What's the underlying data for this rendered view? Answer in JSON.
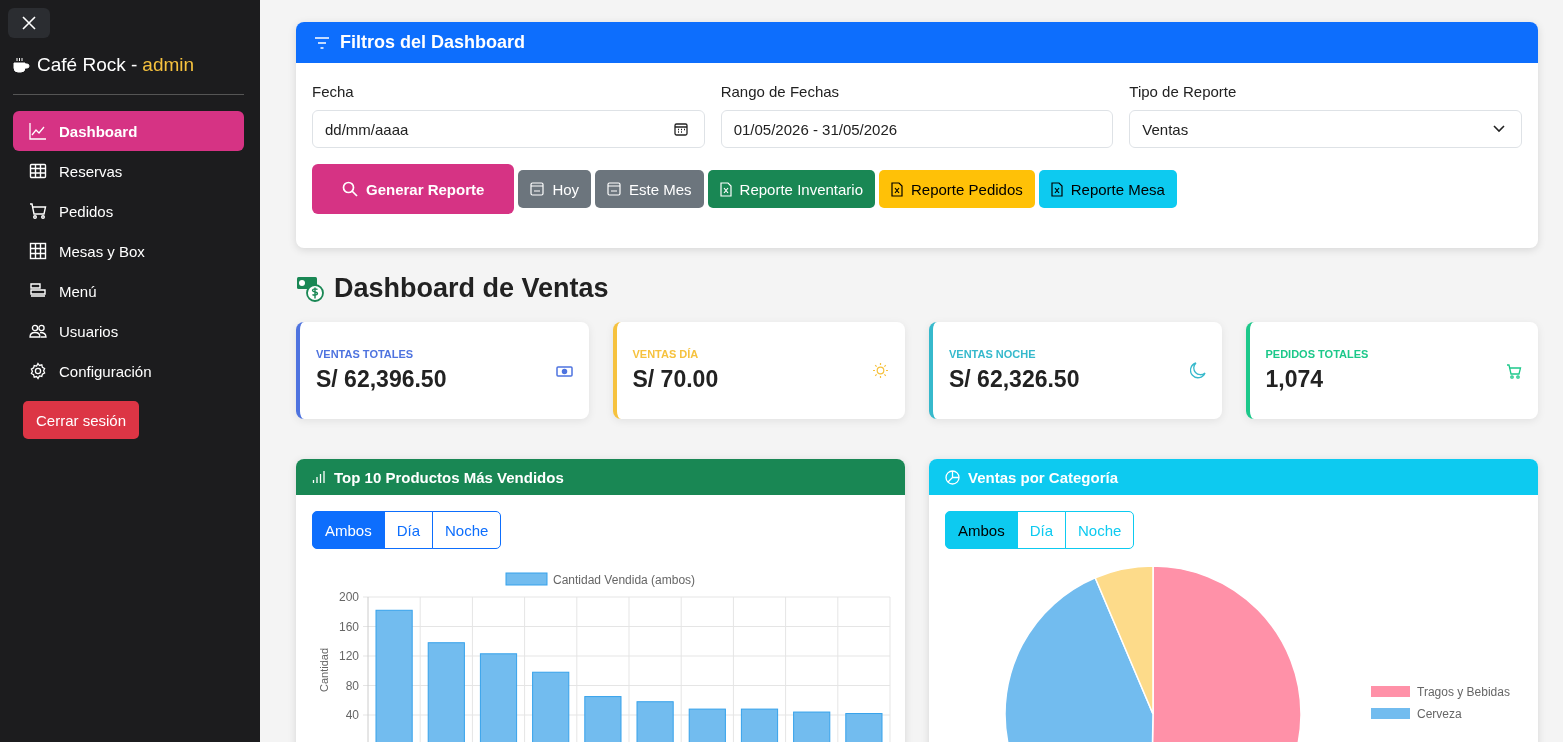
{
  "sidebar": {
    "brand": "Café Rock -",
    "user": "admin",
    "items": [
      {
        "label": "Dashboard",
        "selected": true
      },
      {
        "label": "Reservas",
        "selected": false
      },
      {
        "label": "Pedidos",
        "selected": false
      },
      {
        "label": "Mesas y Box",
        "selected": false
      },
      {
        "label": "Menú",
        "selected": false
      },
      {
        "label": "Usuarios",
        "selected": false
      },
      {
        "label": "Configuración",
        "selected": false
      }
    ],
    "logout": "Cerrar sesión"
  },
  "filters": {
    "title": "Filtros del Dashboard",
    "fields": [
      {
        "label": "Fecha",
        "kind": "date",
        "value": "dd/mm/aaaa"
      },
      {
        "label": "Rango de Fechas",
        "kind": "text",
        "value": "01/05/2026 - 31/05/2026"
      },
      {
        "label": "Tipo de Reporte",
        "kind": "select",
        "value": "Ventas"
      }
    ],
    "buttons": [
      {
        "label": "Generar Reporte",
        "kind": "primary"
      },
      {
        "label": "Hoy",
        "kind": "secondary"
      },
      {
        "label": "Este Mes",
        "kind": "secondary"
      },
      {
        "label": "Reporte Inventario",
        "kind": "success"
      },
      {
        "label": "Reporte Pedidos",
        "kind": "warning"
      },
      {
        "label": "Reporte Mesa",
        "kind": "info"
      }
    ]
  },
  "heading": "Dashboard de Ventas",
  "stats": [
    {
      "label": "VENTAS TOTALES",
      "value": "S/ 62,396.50",
      "color": "#4e73df"
    },
    {
      "label": "VENTAS DÍA",
      "value": "S/ 70.00",
      "color": "#f6c23e"
    },
    {
      "label": "VENTAS NOCHE",
      "value": "S/ 62,326.50",
      "color": "#36b9cc"
    },
    {
      "label": "PEDIDOS TOTALES",
      "value": "1,074",
      "color": "#1cc88a"
    }
  ],
  "top_products": {
    "title": "Top 10 Productos Más Vendidos",
    "toggles": [
      {
        "label": "Ambos",
        "selected": true
      },
      {
        "label": "Día",
        "selected": false
      },
      {
        "label": "Noche",
        "selected": false
      }
    ],
    "chart_data": {
      "type": "bar",
      "grid": true,
      "ylabel": "Cantidad",
      "ylim": [
        0,
        200
      ],
      "yticks": [
        40,
        80,
        120,
        160,
        200
      ],
      "series": [
        {
          "name": "Cantidad Vendida (ambos)",
          "color": "#72bcef",
          "values": [
            182,
            138,
            123,
            98,
            65,
            58,
            48,
            48,
            44,
            42
          ]
        }
      ]
    }
  },
  "categories": {
    "title": "Ventas por Categoría",
    "toggles": [
      {
        "label": "Ambos",
        "selected": true
      },
      {
        "label": "Día",
        "selected": false
      },
      {
        "label": "Noche",
        "selected": false
      }
    ],
    "slices": [
      {
        "color": "#ff91a8"
      },
      {
        "color": "#72bcef"
      },
      {
        "color": "#fddb8a"
      }
    ],
    "legend": [
      {
        "label": "Tragos y Bebidas",
        "color": "#ff91a8"
      },
      {
        "label": "Cerveza",
        "color": "#72bcef"
      }
    ]
  }
}
